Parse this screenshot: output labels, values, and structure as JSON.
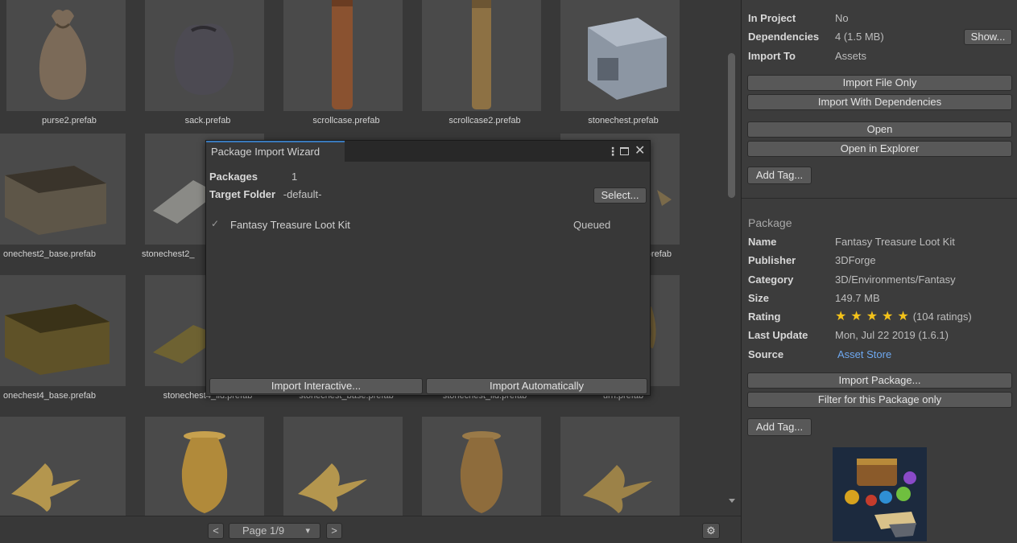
{
  "grid": {
    "rows": [
      [
        "purse2.prefab",
        "sack.prefab",
        "scrollcase.prefab",
        "scrollcase2.prefab",
        "stonechest.prefab"
      ],
      [
        "onechest2_base.prefab",
        "stonechest2_",
        "",
        "",
        "orefab"
      ],
      [
        "onechest4_base.prefab",
        "stonechest4_lid.prefab",
        "stonechest_base.prefab",
        "stonechest_lid.prefab",
        "urn.prefab"
      ]
    ]
  },
  "pager": {
    "prev": "<",
    "page_label": "Page 1/9",
    "dropdown": "▾",
    "next": ">"
  },
  "inspector": {
    "in_project_label": "In Project",
    "in_project_value": "No",
    "dependencies_label": "Dependencies",
    "dependencies_value": "4 (1.5 MB)",
    "show_button": "Show...",
    "import_to_label": "Import To",
    "import_to_value": "Assets",
    "import_file_only": "Import File Only",
    "import_with_dependencies": "Import With Dependencies",
    "open": "Open",
    "open_in_explorer": "Open in Explorer",
    "add_tag": "Add Tag...",
    "package_header": "Package",
    "name_label": "Name",
    "name_value": "Fantasy Treasure Loot Kit",
    "publisher_label": "Publisher",
    "publisher_value": "3DForge",
    "category_label": "Category",
    "category_value": "3D/Environments/Fantasy",
    "size_label": "Size",
    "size_value": "149.7 MB",
    "rating_label": "Rating",
    "rating_stars": 5,
    "rating_text": "(104 ratings)",
    "last_update_label": "Last Update",
    "last_update_value": "Mon, Jul 22 2019 (1.6.1)",
    "source_label": "Source",
    "source_value": "Asset Store",
    "import_package": "Import Package...",
    "filter_package": "Filter for this Package only",
    "add_tag_2": "Add Tag..."
  },
  "dialog": {
    "title": "Package Import Wizard",
    "packages_label": "Packages",
    "packages_value": "1",
    "target_label": "Target Folder",
    "target_value": "-default-",
    "select_button": "Select...",
    "item_name": "Fantasy Treasure Loot Kit",
    "item_status": "Queued",
    "import_interactive": "Import Interactive...",
    "import_automatically": "Import Automatically"
  },
  "colors": {
    "accent": "#3a79bb",
    "link": "#6ea8f0",
    "star": "#f3c21a"
  }
}
